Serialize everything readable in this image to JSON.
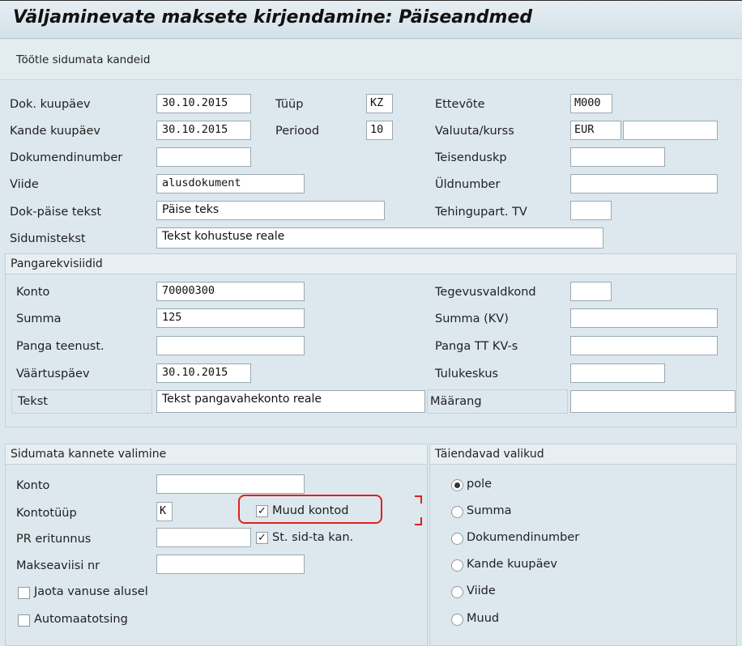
{
  "window": {
    "title": "Väljaminevate maksete kirjendamine: Päiseandmed"
  },
  "toolbar": {
    "process_open_items": "Töötle sidumata kandeid"
  },
  "header": {
    "doc_date_label": "Dok. kuupäev",
    "doc_date": "30.10.2015",
    "type_label": "Tüüp",
    "type": "KZ",
    "company_label": "Ettevõte",
    "company": "M000",
    "posting_date_label": "Kande kuupäev",
    "posting_date": "30.10.2015",
    "period_label": "Periood",
    "period": "10",
    "currency_label": "Valuuta/kurss",
    "currency": "EUR",
    "rate": "",
    "doc_number_label": "Dokumendinumber",
    "doc_number": "",
    "translation_date_label": "Teisenduskp",
    "translation_date": "",
    "reference_label": "Viide",
    "reference": "alusdokument",
    "cross_doc_label": "Üldnumber",
    "cross_doc": "",
    "header_text_label": "Dok-päise tekst",
    "header_text": "Päise teks",
    "trading_partner_label": "Tehingupart. TV",
    "trading_partner": "",
    "clearing_text_label": "Sidumistekst",
    "clearing_text": "Tekst kohustuse reale"
  },
  "bank": {
    "section_title": "Pangarekvisiidid",
    "account_label": "Konto",
    "account": "70000300",
    "business_area_label": "Tegevusvaldkond",
    "business_area": "",
    "amount_label": "Summa",
    "amount": "125",
    "amount_lc_label": "Summa (KV)",
    "amount_lc": "",
    "bank_charges_label": "Panga teenust.",
    "bank_charges": "",
    "bank_charges_lc_label": "Panga TT KV-s",
    "bank_charges_lc": "",
    "value_date_label": "Väärtuspäev",
    "value_date": "30.10.2015",
    "profit_center_label": "Tulukeskus",
    "profit_center": "",
    "text_label": "Tekst",
    "text": "Tekst pangavahekonto reale",
    "assignment_label": "Määrang",
    "assignment": ""
  },
  "open_item_selection": {
    "section_title": "Sidumata kannete valimine",
    "account_label": "Konto",
    "account": "",
    "account_type_label": "Kontotüüp",
    "account_type": "K",
    "other_accounts_label": "Muud kontod",
    "other_accounts_checked": true,
    "special_gl_label": "PR eritunnus",
    "special_gl": "",
    "standard_oi_label": "St. sid-ta kan.",
    "standard_oi_checked": true,
    "payment_advice_label": "Makseaviisi nr",
    "payment_advice": "",
    "distribute_by_age_label": "Jaota vanuse alusel",
    "distribute_by_age_checked": false,
    "automatic_search_label": "Automaatotsing",
    "automatic_search_checked": false
  },
  "additional_selections": {
    "section_title": "Täiendavad valikud",
    "options": [
      "pole",
      "Summa",
      "Dokumendinumber",
      "Kande kuupäev",
      "Viide",
      "Muud"
    ],
    "selected": "pole"
  },
  "colors": {
    "highlight": "#e02020",
    "background": "#dde8ee"
  }
}
